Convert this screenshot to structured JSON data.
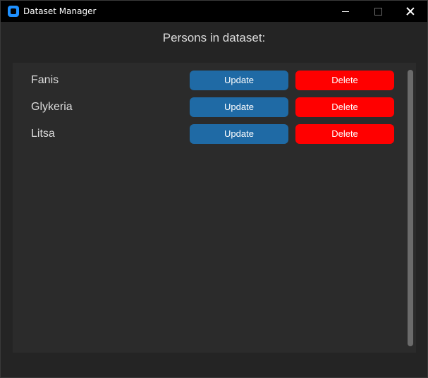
{
  "window": {
    "title": "Dataset Manager",
    "icon": "app-icon"
  },
  "titlebar_controls": {
    "minimize_icon": "minimize-icon",
    "maximize_icon": "maximize-icon",
    "close_icon": "close-icon"
  },
  "main": {
    "heading": "Persons in dataset:"
  },
  "persons": [
    {
      "name": "Fanis",
      "update_label": "Update",
      "delete_label": "Delete"
    },
    {
      "name": "Glykeria",
      "update_label": "Update",
      "delete_label": "Delete"
    },
    {
      "name": "Litsa",
      "update_label": "Update",
      "delete_label": "Delete"
    }
  ],
  "colors": {
    "update_button": "#1f6aa5",
    "delete_button": "#ff0000",
    "panel_background": "#2b2b2b",
    "window_background": "#242424",
    "titlebar": "#000000"
  }
}
